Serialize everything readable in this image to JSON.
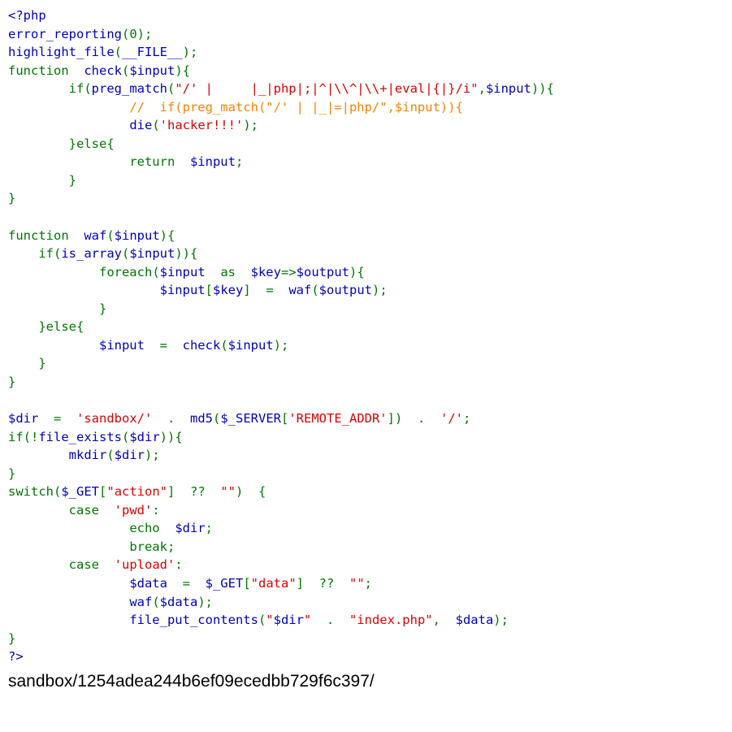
{
  "page": {
    "background_color": "#ffffff",
    "description": "Browser rendering of a PHP file printed via highlight_file(), followed by the script's echoed output line."
  },
  "colors": {
    "keyword": "#007700",
    "string": "#DD0000",
    "comment": "#FF8000",
    "default": "#0000BB",
    "output_text": "#000000"
  },
  "source": {
    "language": "php",
    "lines": [
      [
        {
          "t": "<?php",
          "c": "def"
        }
      ],
      [
        {
          "t": "error_reporting",
          "c": "def"
        },
        {
          "t": "(",
          "c": "kw"
        },
        {
          "t": "0",
          "c": "kw"
        },
        {
          "t": ")",
          "c": "kw"
        },
        {
          "t": ";",
          "c": "kw"
        }
      ],
      [
        {
          "t": "highlight_file",
          "c": "def"
        },
        {
          "t": "(",
          "c": "kw"
        },
        {
          "t": "__FILE__",
          "c": "def"
        },
        {
          "t": ")",
          "c": "kw"
        },
        {
          "t": ";",
          "c": "kw"
        }
      ],
      [
        {
          "t": "function ",
          "c": "kw"
        },
        {
          "t": " check",
          "c": "def"
        },
        {
          "t": "(",
          "c": "kw"
        },
        {
          "t": "$input",
          "c": "def"
        },
        {
          "t": ")",
          "c": "kw"
        },
        {
          "t": "{",
          "c": "kw"
        }
      ],
      [
        {
          "t": "        ",
          "c": "kw"
        },
        {
          "t": "if",
          "c": "kw"
        },
        {
          "t": "(",
          "c": "kw"
        },
        {
          "t": "preg_match",
          "c": "def"
        },
        {
          "t": "(",
          "c": "kw"
        },
        {
          "t": "\"/' |\t|_|php|;|^|\\\\^|\\\\+|eval|{|}/i\"",
          "c": "str"
        },
        {
          "t": ",",
          "c": "kw"
        },
        {
          "t": "$input",
          "c": "def"
        },
        {
          "t": "))",
          "c": "kw"
        },
        {
          "t": "{",
          "c": "kw"
        }
      ],
      [
        {
          "t": "                ",
          "c": "kw"
        },
        {
          "t": "//  if(preg_match(\"/' |\t|_|=|php/\",$input)){",
          "c": "cmt"
        }
      ],
      [
        {
          "t": "                ",
          "c": "kw"
        },
        {
          "t": "die",
          "c": "def"
        },
        {
          "t": "(",
          "c": "kw"
        },
        {
          "t": "'hacker!!!'",
          "c": "str"
        },
        {
          "t": ")",
          "c": "kw"
        },
        {
          "t": ";",
          "c": "kw"
        }
      ],
      [
        {
          "t": "        }",
          "c": "kw"
        },
        {
          "t": "else",
          "c": "kw"
        },
        {
          "t": "{",
          "c": "kw"
        }
      ],
      [
        {
          "t": "                ",
          "c": "kw"
        },
        {
          "t": "return ",
          "c": "kw"
        },
        {
          "t": " $input",
          "c": "def"
        },
        {
          "t": ";",
          "c": "kw"
        }
      ],
      [
        {
          "t": "        }",
          "c": "kw"
        }
      ],
      [
        {
          "t": "}",
          "c": "kw"
        }
      ],
      [
        {
          "t": "",
          "c": "kw"
        }
      ],
      [
        {
          "t": "function ",
          "c": "kw"
        },
        {
          "t": " waf",
          "c": "def"
        },
        {
          "t": "(",
          "c": "kw"
        },
        {
          "t": "$input",
          "c": "def"
        },
        {
          "t": ")",
          "c": "kw"
        },
        {
          "t": "{",
          "c": "kw"
        }
      ],
      [
        {
          "t": "    ",
          "c": "kw"
        },
        {
          "t": "if",
          "c": "kw"
        },
        {
          "t": "(",
          "c": "kw"
        },
        {
          "t": "is_array",
          "c": "def"
        },
        {
          "t": "(",
          "c": "kw"
        },
        {
          "t": "$input",
          "c": "def"
        },
        {
          "t": "))",
          "c": "kw"
        },
        {
          "t": "{",
          "c": "kw"
        }
      ],
      [
        {
          "t": "            ",
          "c": "kw"
        },
        {
          "t": "foreach",
          "c": "kw"
        },
        {
          "t": "(",
          "c": "kw"
        },
        {
          "t": "$input ",
          "c": "def"
        },
        {
          "t": " as ",
          "c": "kw"
        },
        {
          "t": " $key",
          "c": "def"
        },
        {
          "t": "=>",
          "c": "kw"
        },
        {
          "t": "$output",
          "c": "def"
        },
        {
          "t": ")",
          "c": "kw"
        },
        {
          "t": "{",
          "c": "kw"
        }
      ],
      [
        {
          "t": "                    ",
          "c": "kw"
        },
        {
          "t": "$input",
          "c": "def"
        },
        {
          "t": "[",
          "c": "kw"
        },
        {
          "t": "$key",
          "c": "def"
        },
        {
          "t": "] ",
          "c": "kw"
        },
        {
          "t": " = ",
          "c": "kw"
        },
        {
          "t": " waf",
          "c": "def"
        },
        {
          "t": "(",
          "c": "kw"
        },
        {
          "t": "$output",
          "c": "def"
        },
        {
          "t": ")",
          "c": "kw"
        },
        {
          "t": ";",
          "c": "kw"
        }
      ],
      [
        {
          "t": "            }",
          "c": "kw"
        }
      ],
      [
        {
          "t": "    }",
          "c": "kw"
        },
        {
          "t": "else",
          "c": "kw"
        },
        {
          "t": "{",
          "c": "kw"
        }
      ],
      [
        {
          "t": "            ",
          "c": "kw"
        },
        {
          "t": "$input ",
          "c": "def"
        },
        {
          "t": " = ",
          "c": "kw"
        },
        {
          "t": " check",
          "c": "def"
        },
        {
          "t": "(",
          "c": "kw"
        },
        {
          "t": "$input",
          "c": "def"
        },
        {
          "t": ")",
          "c": "kw"
        },
        {
          "t": ";",
          "c": "kw"
        }
      ],
      [
        {
          "t": "    }",
          "c": "kw"
        }
      ],
      [
        {
          "t": "}",
          "c": "kw"
        }
      ],
      [
        {
          "t": "",
          "c": "kw"
        }
      ],
      [
        {
          "t": "$dir ",
          "c": "def"
        },
        {
          "t": " = ",
          "c": "kw"
        },
        {
          "t": " 'sandbox/' ",
          "c": "str"
        },
        {
          "t": " . ",
          "c": "kw"
        },
        {
          "t": " md5",
          "c": "def"
        },
        {
          "t": "(",
          "c": "kw"
        },
        {
          "t": "$_SERVER",
          "c": "def"
        },
        {
          "t": "[",
          "c": "kw"
        },
        {
          "t": "'REMOTE_ADDR'",
          "c": "str"
        },
        {
          "t": "]) ",
          "c": "kw"
        },
        {
          "t": " . ",
          "c": "kw"
        },
        {
          "t": " '/'",
          "c": "str"
        },
        {
          "t": ";",
          "c": "kw"
        }
      ],
      [
        {
          "t": "if",
          "c": "kw"
        },
        {
          "t": "(!",
          "c": "kw"
        },
        {
          "t": "file_exists",
          "c": "def"
        },
        {
          "t": "(",
          "c": "kw"
        },
        {
          "t": "$dir",
          "c": "def"
        },
        {
          "t": "))",
          "c": "kw"
        },
        {
          "t": "{",
          "c": "kw"
        }
      ],
      [
        {
          "t": "        ",
          "c": "kw"
        },
        {
          "t": "mkdir",
          "c": "def"
        },
        {
          "t": "(",
          "c": "kw"
        },
        {
          "t": "$dir",
          "c": "def"
        },
        {
          "t": ")",
          "c": "kw"
        },
        {
          "t": ";",
          "c": "kw"
        }
      ],
      [
        {
          "t": "}",
          "c": "kw"
        }
      ],
      [
        {
          "t": "switch",
          "c": "kw"
        },
        {
          "t": "(",
          "c": "kw"
        },
        {
          "t": "$_GET",
          "c": "def"
        },
        {
          "t": "[",
          "c": "kw"
        },
        {
          "t": "\"action\"",
          "c": "str"
        },
        {
          "t": "] ",
          "c": "kw"
        },
        {
          "t": " ?? ",
          "c": "kw"
        },
        {
          "t": " \"\"",
          "c": "str"
        },
        {
          "t": ") ",
          "c": "kw"
        },
        {
          "t": " {",
          "c": "kw"
        }
      ],
      [
        {
          "t": "        ",
          "c": "kw"
        },
        {
          "t": "case ",
          "c": "kw"
        },
        {
          "t": " 'pwd'",
          "c": "str"
        },
        {
          "t": ":",
          "c": "kw"
        }
      ],
      [
        {
          "t": "                ",
          "c": "kw"
        },
        {
          "t": "echo ",
          "c": "kw"
        },
        {
          "t": " $dir",
          "c": "def"
        },
        {
          "t": ";",
          "c": "kw"
        }
      ],
      [
        {
          "t": "                ",
          "c": "kw"
        },
        {
          "t": "break",
          "c": "kw"
        },
        {
          "t": ";",
          "c": "kw"
        }
      ],
      [
        {
          "t": "        ",
          "c": "kw"
        },
        {
          "t": "case ",
          "c": "kw"
        },
        {
          "t": " 'upload'",
          "c": "str"
        },
        {
          "t": ":",
          "c": "kw"
        }
      ],
      [
        {
          "t": "                ",
          "c": "kw"
        },
        {
          "t": "$data ",
          "c": "def"
        },
        {
          "t": " = ",
          "c": "kw"
        },
        {
          "t": " $_GET",
          "c": "def"
        },
        {
          "t": "[",
          "c": "kw"
        },
        {
          "t": "\"data\"",
          "c": "str"
        },
        {
          "t": "] ",
          "c": "kw"
        },
        {
          "t": " ?? ",
          "c": "kw"
        },
        {
          "t": " \"\"",
          "c": "str"
        },
        {
          "t": ";",
          "c": "kw"
        }
      ],
      [
        {
          "t": "                ",
          "c": "kw"
        },
        {
          "t": "waf",
          "c": "def"
        },
        {
          "t": "(",
          "c": "kw"
        },
        {
          "t": "$data",
          "c": "def"
        },
        {
          "t": ")",
          "c": "kw"
        },
        {
          "t": ";",
          "c": "kw"
        }
      ],
      [
        {
          "t": "                ",
          "c": "kw"
        },
        {
          "t": "file_put_contents",
          "c": "def"
        },
        {
          "t": "(",
          "c": "kw"
        },
        {
          "t": "\"",
          "c": "str"
        },
        {
          "t": "$dir",
          "c": "def"
        },
        {
          "t": "\" ",
          "c": "str"
        },
        {
          "t": " . ",
          "c": "kw"
        },
        {
          "t": " \"index.php\"",
          "c": "str"
        },
        {
          "t": ", ",
          "c": "kw"
        },
        {
          "t": " $data",
          "c": "def"
        },
        {
          "t": ")",
          "c": "kw"
        },
        {
          "t": ";",
          "c": "kw"
        }
      ],
      [
        {
          "t": "}",
          "c": "kw"
        }
      ],
      [
        {
          "t": "?>",
          "c": "def"
        }
      ]
    ]
  },
  "output": {
    "echoed_path": "sandbox/1254adea244b6ef09ecedbb729f6c397/",
    "dir_prefix": "sandbox/",
    "md5_hash": "1254adea244b6ef09ecedbb729f6c397"
  }
}
